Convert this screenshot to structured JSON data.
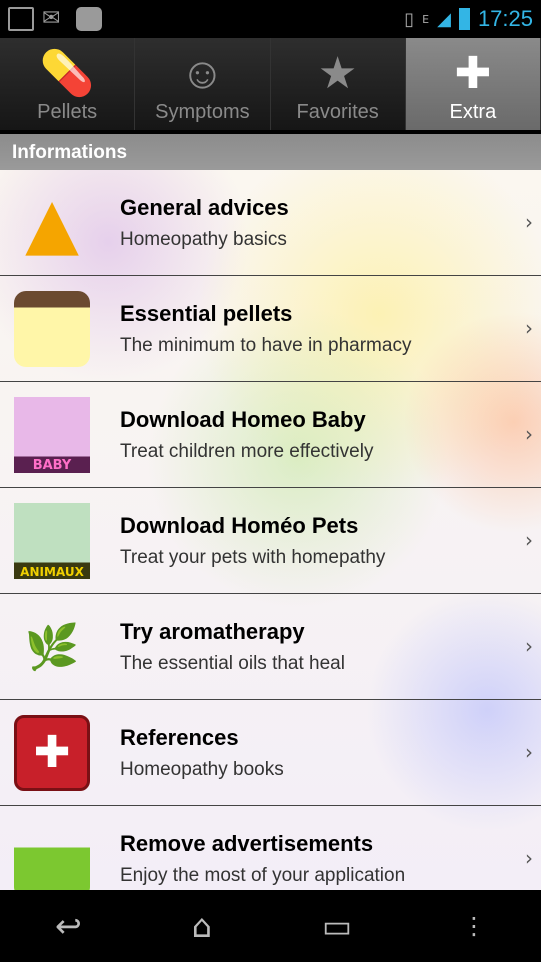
{
  "status": {
    "time": "17:25",
    "network": "E",
    "icons": [
      "image-icon",
      "gmail-icon",
      "upload-icon",
      "vibrate-icon",
      "signal-icon",
      "battery-icon"
    ]
  },
  "tabs": [
    {
      "label": "Pellets",
      "icon": "pellets-icon"
    },
    {
      "label": "Symptoms",
      "icon": "nurse-icon"
    },
    {
      "label": "Favorites",
      "icon": "star-icon"
    },
    {
      "label": "Extra",
      "icon": "medkit-icon",
      "active": true
    }
  ],
  "section": "Informations",
  "items": [
    {
      "title": "General advices",
      "subtitle": "Homeopathy basics",
      "icon": "warning-icon"
    },
    {
      "title": "Essential pellets",
      "subtitle": "The minimum to have in pharmacy",
      "icon": "notepad-icon"
    },
    {
      "title": "Download Homeo Baby",
      "subtitle": "Treat children more effectively",
      "icon": "homeo-baby-icon",
      "badge": "BABY"
    },
    {
      "title": "Download Homéo Pets",
      "subtitle": "Treat your pets with homepathy",
      "icon": "homeo-pets-icon",
      "badge": "ANIMAUX"
    },
    {
      "title": "Try aromatherapy",
      "subtitle": "The essential oils that heal",
      "icon": "aromatherapy-icon"
    },
    {
      "title": "References",
      "subtitle": "Homeopathy books",
      "icon": "book-icon"
    },
    {
      "title": "Remove advertisements",
      "subtitle": "Enjoy the most of your application",
      "icon": "basket-icon"
    }
  ]
}
